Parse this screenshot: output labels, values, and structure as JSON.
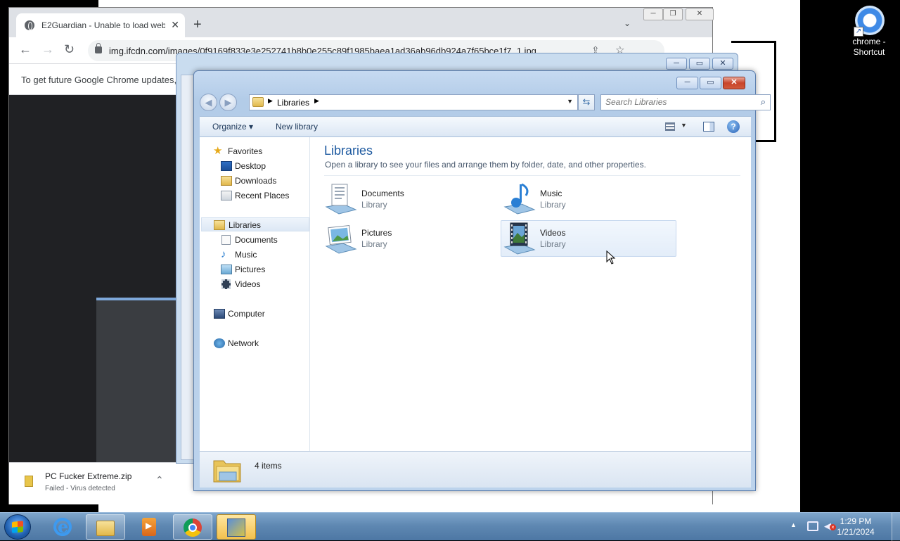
{
  "chrome": {
    "tab_title": "E2Guardian - Unable to load web",
    "url": "img.ifcdn.com/images/0f9169f833e3e252741b8b0e255c89f1985baea1ad36ab96db924a7f65bce1f7_1.jpg",
    "infobar_text": "To get future Google Chrome updates,",
    "download": {
      "filename": "PC Fucker Extreme.zip",
      "status": "Failed - Virus detected"
    }
  },
  "desktop": {
    "shortcut_label_1": "chrome -",
    "shortcut_label_2": "Shortcut"
  },
  "explorer": {
    "breadcrumb": "Libraries",
    "search_placeholder": "Search Libraries",
    "toolbar": {
      "organize": "Organize",
      "new_library": "New library"
    },
    "nav": {
      "favorites": "Favorites",
      "desktop": "Desktop",
      "downloads": "Downloads",
      "recent_places": "Recent Places",
      "libraries": "Libraries",
      "documents": "Documents",
      "music": "Music",
      "pictures": "Pictures",
      "videos": "Videos",
      "computer": "Computer",
      "network": "Network"
    },
    "content": {
      "title": "Libraries",
      "description": "Open a library to see your files and arrange them by folder, date, and other properties.",
      "items": [
        {
          "name": "Documents",
          "type": "Library"
        },
        {
          "name": "Music",
          "type": "Library"
        },
        {
          "name": "Pictures",
          "type": "Library"
        },
        {
          "name": "Videos",
          "type": "Library"
        }
      ]
    },
    "status": "4 items"
  },
  "taskbar": {
    "time": "1:29 PM",
    "date": "1/21/2024"
  }
}
